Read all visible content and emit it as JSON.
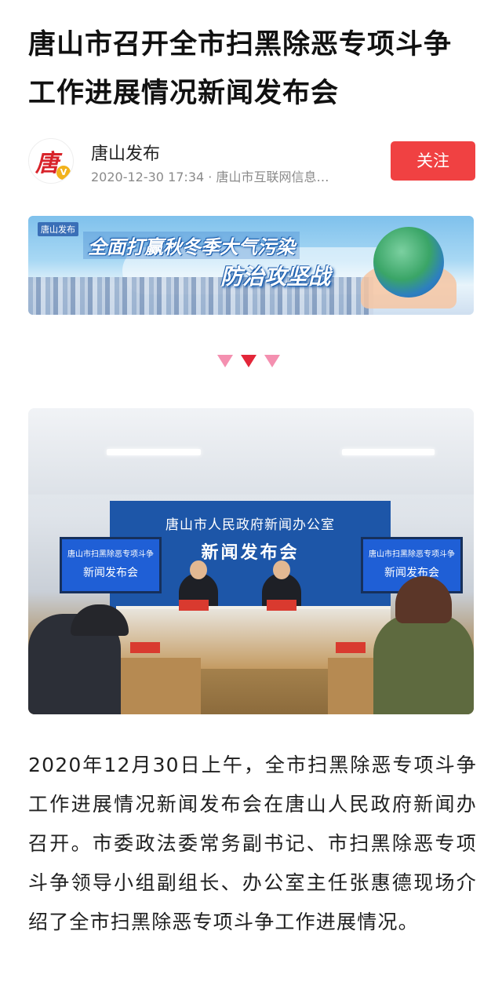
{
  "article": {
    "title": "唐山市召开全市扫黑除恶专项斗争工作进展情况新闻发布会",
    "body": "2020年12月30日上午，全市扫黑除恶专项斗争工作进展情况新闻发布会在唐山人民政府新闻办召开。市委政法委常务副书记、市扫黑除恶专项斗争领导小组副组长、办公室主任张惠德现场介绍了全市扫黑除恶专项斗争工作进展情况。"
  },
  "author": {
    "name": "唐山发布",
    "avatar_glyph": "唐",
    "verified_badge": "V",
    "meta": "2020-12-30 17:34 · 唐山市互联网信息…",
    "follow_label": "关注"
  },
  "banner": {
    "logo": "唐山发布",
    "line1": "全面打赢秋冬季大气污染",
    "line2": "防治攻坚战"
  },
  "photo": {
    "backdrop_line1": "唐山市人民政府新闻办公室",
    "backdrop_line2": "新闻发布会",
    "screen_line1": "唐山市扫黑除恶专项斗争",
    "screen_line2": "新闻发布会"
  },
  "colors": {
    "accent": "#f04142",
    "heart_light": "#f490b0",
    "heart_dark": "#e32639",
    "meta_gray": "#8a8a8a"
  },
  "icons": {
    "avatar": "tangshan-logo",
    "badge": "verified-v-icon",
    "divider": "heart-divider-icons"
  }
}
